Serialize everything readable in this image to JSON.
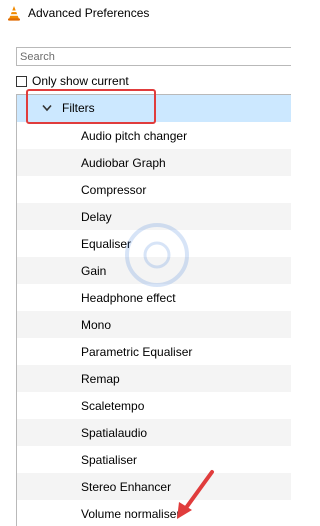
{
  "window": {
    "title": "Advanced Preferences",
    "icon": "vlc-cone-icon"
  },
  "search": {
    "placeholder": "Search",
    "value": ""
  },
  "only_show_current": {
    "label": "Only show current",
    "checked": false
  },
  "tree": {
    "expanded_item": "Filters",
    "children": [
      "Audio pitch changer",
      "Audiobar Graph",
      "Compressor",
      "Delay",
      "Equaliser",
      "Gain",
      "Headphone effect",
      "Mono",
      "Parametric Equaliser",
      "Remap",
      "Scaletempo",
      "Spatialaudio",
      "Spatialiser",
      "Stereo Enhancer",
      "Volume normaliser"
    ]
  },
  "colors": {
    "selection": "#cce8ff",
    "annotation": "#e03c3c",
    "alt_row": "#f4f4f4"
  }
}
